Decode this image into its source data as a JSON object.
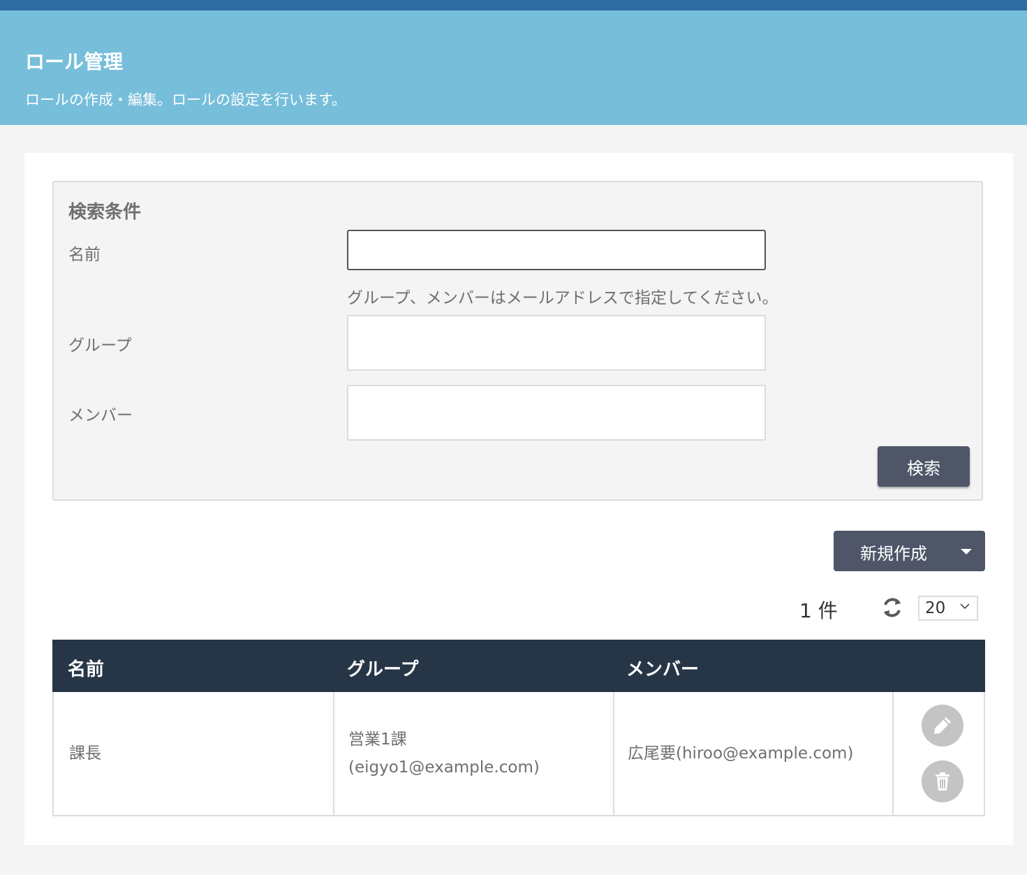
{
  "header": {
    "title": "ロール管理",
    "subtitle": "ロールの作成・編集。ロールの設定を行います。"
  },
  "search": {
    "title": "検索条件",
    "name_label": "名前",
    "name_value": "",
    "hint": "グループ、メンバーはメールアドレスで指定してください。",
    "group_label": "グループ",
    "group_value": "",
    "member_label": "メンバー",
    "member_value": "",
    "search_button": "検索"
  },
  "toolbar": {
    "new_button": "新規作成",
    "count_text": "1 件",
    "page_size": "20",
    "icons": {
      "refresh": "refresh-icon",
      "dropdown": "caret-down-icon"
    }
  },
  "table": {
    "columns": [
      "名前",
      "グループ",
      "メンバー"
    ],
    "rows": [
      {
        "name": "課長",
        "group_line1": "営業1課",
        "group_line2": "(eigyo1@example.com)",
        "member": "広尾要(hiroo@example.com)"
      }
    ],
    "row_actions": [
      "edit-icon",
      "delete-icon"
    ]
  },
  "colors": {
    "topbar": "#2f6ca3",
    "header": "#77bedb",
    "dark_button": "#4e5668",
    "table_header": "#263646",
    "action_icon_bg": "#c4c4c4"
  }
}
